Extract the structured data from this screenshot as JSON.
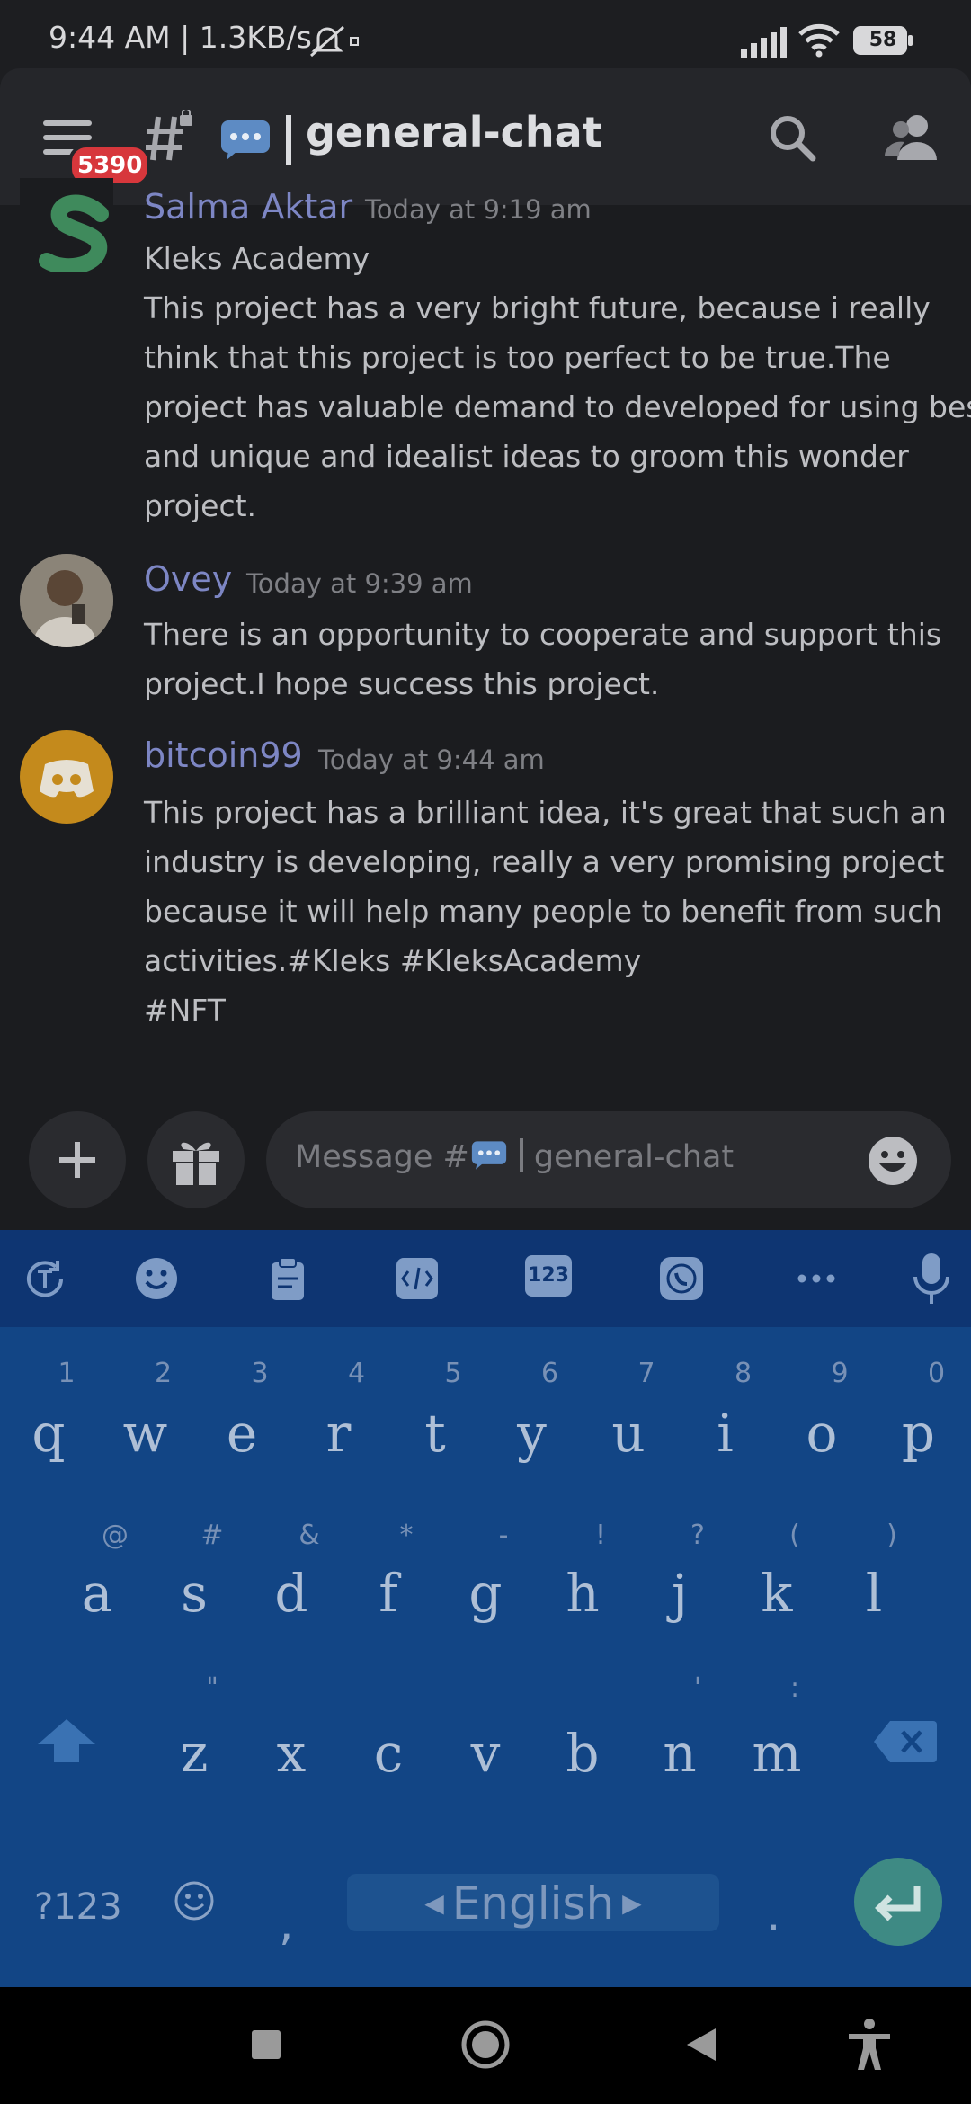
{
  "status_bar": {
    "time_and_speed": "9:44 AM | 1.3KB/s",
    "battery": "58"
  },
  "header": {
    "mention_count": "5390",
    "channel_name": "general-chat"
  },
  "messages": [
    {
      "author": "Salma Aktar",
      "time": "Today at 9:19 am",
      "lines": [
        "Kleks Academy",
        "This project has a very bright future, because i really",
        "think that this project is too perfect to be true.The",
        "project has valuable demand to developed for using best",
        "and unique and idealist ideas to groom this wonder",
        "project."
      ]
    },
    {
      "author": "Ovey",
      "time": "Today at 9:39 am",
      "lines": [
        "There is an opportunity to cooperate and support this",
        "project.I hope success this project."
      ]
    },
    {
      "author": "bitcoin99",
      "time": "Today at 9:44 am",
      "lines": [
        "This project has a brilliant idea, it's great that such an",
        "industry is developing, really a very promising project",
        "because it will help many people to benefit from such",
        "activities.#Kleks #KleksAcademy",
        "#NFT"
      ]
    }
  ],
  "composer": {
    "placeholder_prefix": "Message #",
    "placeholder_channel": "general-chat"
  },
  "keyboard": {
    "toolbar_numbers_label": "123",
    "row1": [
      "q",
      "w",
      "e",
      "r",
      "t",
      "y",
      "u",
      "i",
      "o",
      "p"
    ],
    "row1_hints": [
      "1",
      "2",
      "3",
      "4",
      "5",
      "6",
      "7",
      "8",
      "9",
      "0"
    ],
    "row2": [
      "a",
      "s",
      "d",
      "f",
      "g",
      "h",
      "j",
      "k",
      "l"
    ],
    "row2_hints": [
      "@",
      "#",
      "&",
      "*",
      "-",
      "!",
      "?",
      "(",
      ")"
    ],
    "row3": [
      "z",
      "x",
      "c",
      "v",
      "b",
      "n",
      "m"
    ],
    "row3_hints": [
      "\"",
      "",
      "",
      "",
      "",
      "'",
      ":",
      "/"
    ],
    "symbols_key": "?123",
    "comma_key": ",",
    "period_key": ".",
    "language": "English"
  },
  "colors": {
    "accent_name": "#7d86c4",
    "keyboard_bg": "#124585",
    "enter_key": "#3e8a84",
    "badge": "#d7373c"
  }
}
